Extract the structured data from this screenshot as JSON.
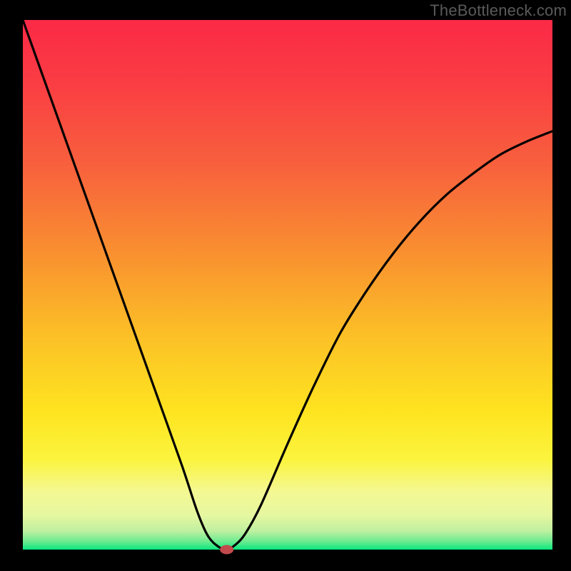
{
  "watermark": "TheBottleneck.com",
  "chart_data": {
    "type": "line",
    "title": "",
    "xlabel": "",
    "ylabel": "",
    "xlim": [
      0,
      100
    ],
    "ylim": [
      0,
      100
    ],
    "x": [
      0,
      5,
      10,
      15,
      20,
      25,
      30,
      33,
      35,
      37,
      38.5,
      40,
      42,
      45,
      50,
      55,
      60,
      65,
      70,
      75,
      80,
      85,
      90,
      95,
      100
    ],
    "values": [
      100,
      86,
      72,
      58,
      44,
      30,
      16,
      7,
      2.5,
      0.5,
      0,
      0.8,
      3,
      8.5,
      20,
      31,
      41,
      49,
      56,
      62,
      67,
      71,
      74.5,
      77,
      79
    ],
    "minimum_marker": {
      "x": 38.5,
      "y": 0
    },
    "background": {
      "type": "vertical_gradient",
      "colors": [
        "#fb2946",
        "#f8623d",
        "#f9a72c",
        "#fee420",
        "#f6f88e",
        "#dff6ad",
        "#09e77e"
      ]
    },
    "border_color": "#000000",
    "curve_color": "#000000"
  },
  "colors": {
    "marker_fill": "#c24a4d",
    "marker_stroke": "#c24a4d"
  }
}
